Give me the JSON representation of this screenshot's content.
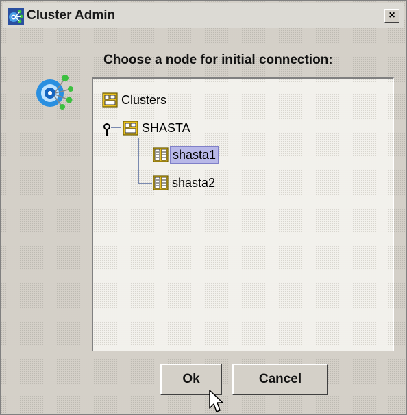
{
  "window": {
    "title": "Cluster Admin",
    "close_glyph": "×"
  },
  "dialog": {
    "prompt": "Choose a node for initial connection:"
  },
  "tree": {
    "root": {
      "label": "Clusters",
      "icon": "cluster-folder-icon"
    },
    "cluster": {
      "label": "SHASTA",
      "icon": "cluster-folder-icon",
      "expanded": true
    },
    "nodes": [
      {
        "label": "shasta1",
        "icon": "server-node-icon",
        "selected": true
      },
      {
        "label": "shasta2",
        "icon": "server-node-icon",
        "selected": false
      }
    ]
  },
  "buttons": {
    "ok_label": "Ok",
    "cancel_label": "Cancel"
  },
  "colors": {
    "background": "#d4d0c8",
    "selection": "#b8b8e8",
    "icon_yellow": "#e8c020"
  }
}
